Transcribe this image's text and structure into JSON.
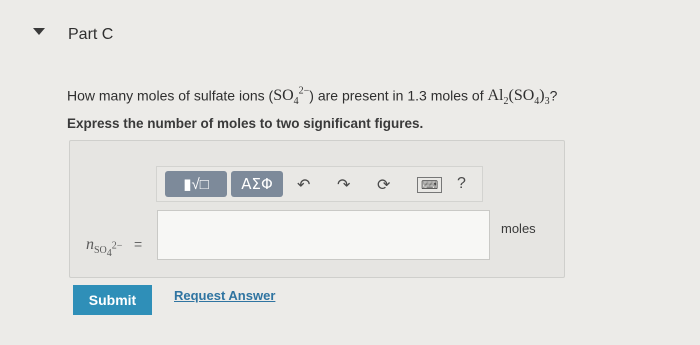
{
  "part": {
    "title": "Part C"
  },
  "question": {
    "prefix": "How many moles of sulfate ions (",
    "ion_symbol": "SO",
    "ion_subscript": "4",
    "ion_charge": "2−",
    "middle": ") are present in 1.3 moles of ",
    "compound_al": "Al",
    "compound_al_sub": "2",
    "compound_group": "(SO",
    "compound_group_sub": "4",
    "compound_group_close": ")",
    "compound_outer_sub": "3",
    "suffix": "?"
  },
  "instruction": "Express the number of moles to two significant figures.",
  "toolbar": {
    "templates_icon": "templates-icon",
    "templates_text": "▮√□",
    "greek_label": "ΑΣΦ",
    "undo_icon": "undo-icon",
    "redo_icon": "redo-icon",
    "reset_icon": "reset-icon",
    "keyboard_icon": "keyboard-icon",
    "help_label": "?"
  },
  "answer": {
    "var": "n",
    "var_sub_base": "SO",
    "var_sub_num": "4",
    "var_charge": "2−",
    "equals": "=",
    "value": "",
    "units": "moles"
  },
  "actions": {
    "submit_label": "Submit",
    "request_label": "Request Answer"
  }
}
